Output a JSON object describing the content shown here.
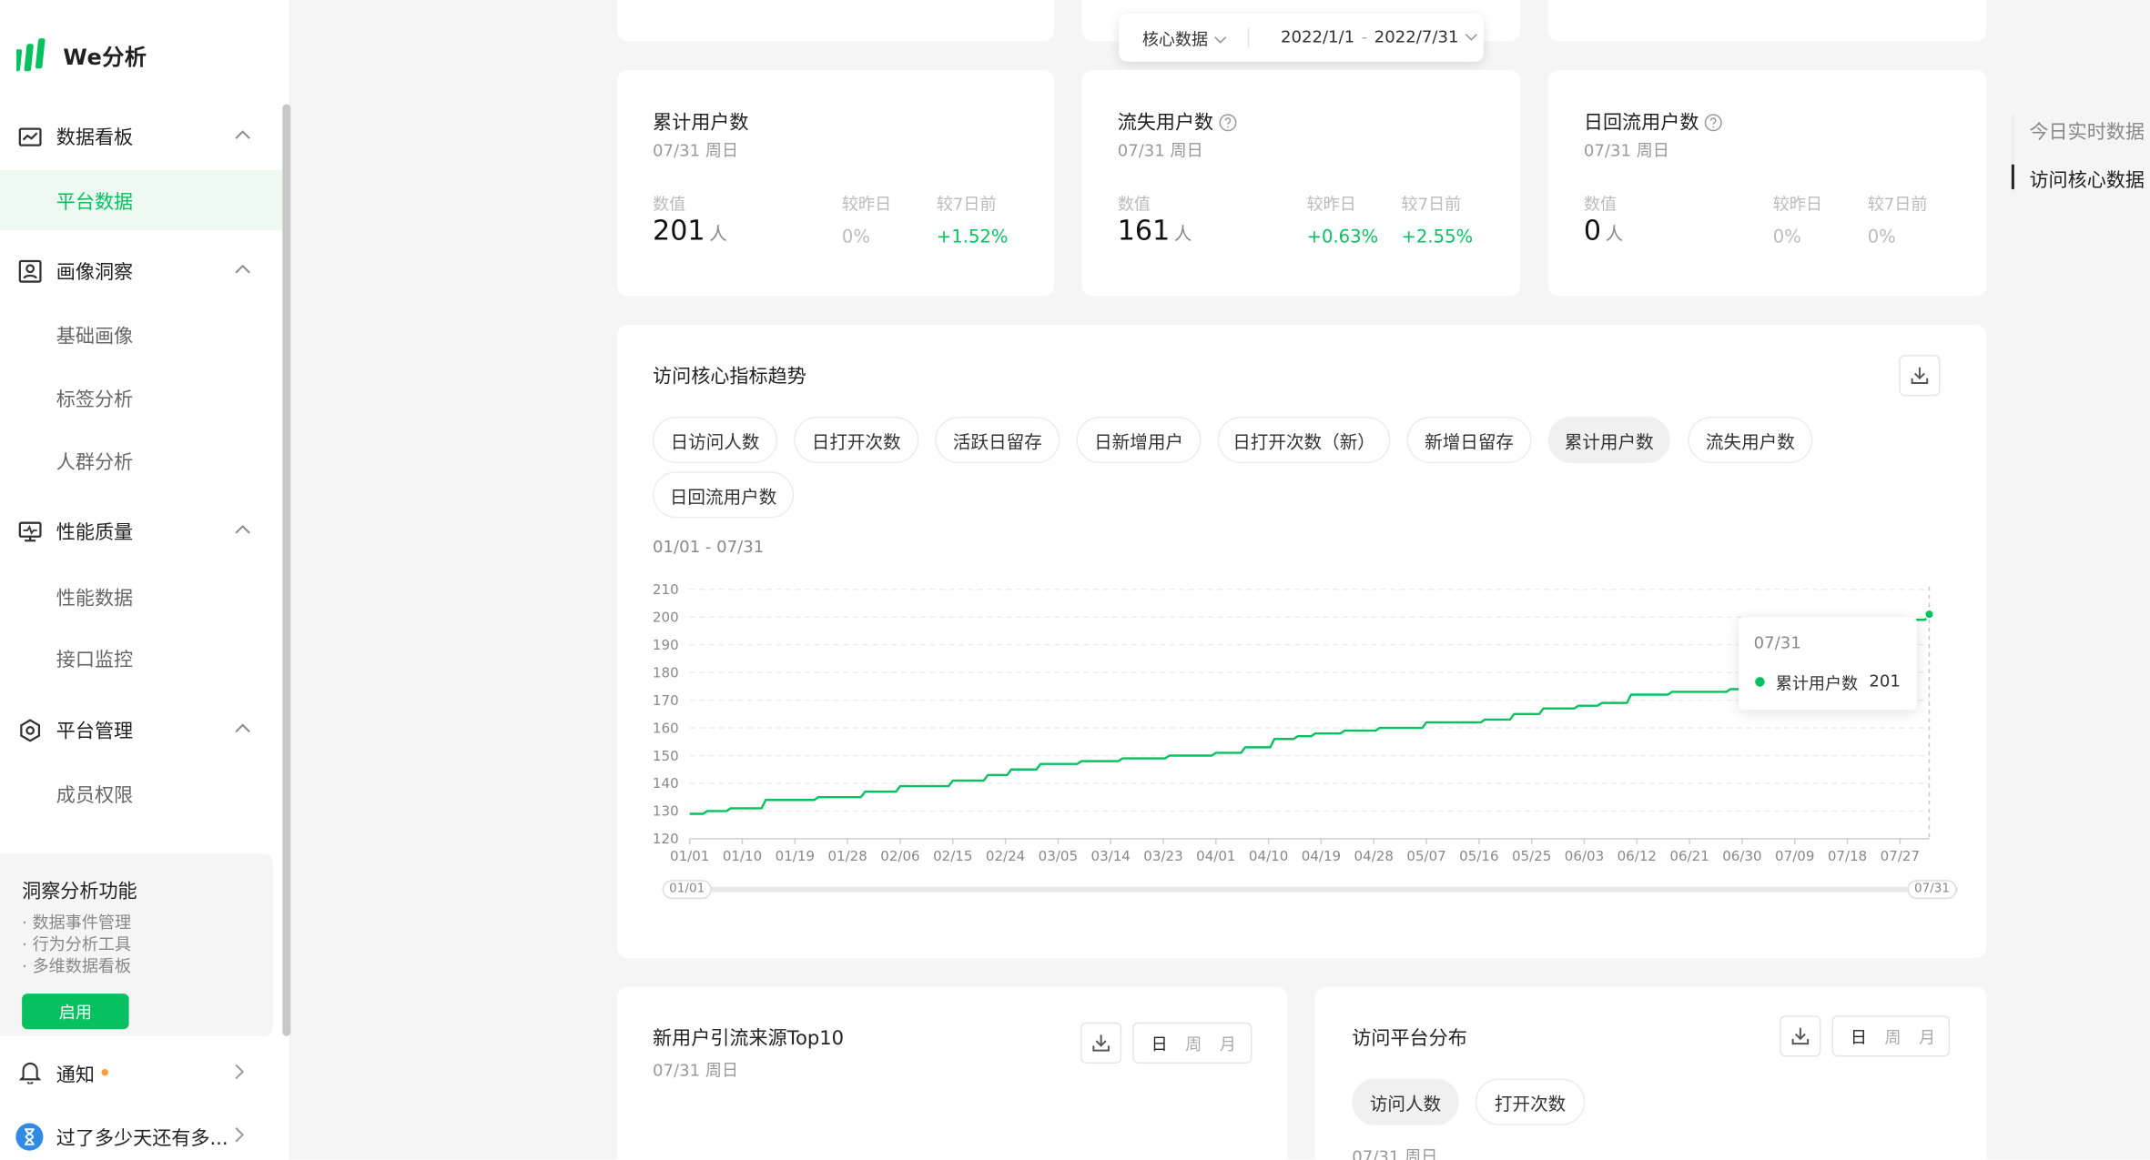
{
  "app": {
    "name": "We分析"
  },
  "sidebar": {
    "groups": [
      {
        "label": "数据看板",
        "items": [
          {
            "label": "平台数据",
            "active": true
          }
        ]
      },
      {
        "label": "画像洞察",
        "items": [
          {
            "label": "基础画像"
          },
          {
            "label": "标签分析"
          },
          {
            "label": "人群分析"
          }
        ]
      },
      {
        "label": "性能质量",
        "items": [
          {
            "label": "性能数据"
          },
          {
            "label": "接口监控"
          }
        ]
      },
      {
        "label": "平台管理",
        "items": [
          {
            "label": "成员权限"
          }
        ]
      }
    ],
    "promo": {
      "title": "洞察分析功能",
      "features": [
        "· 数据事件管理",
        "· 行为分析工具",
        "· 多维数据看板"
      ],
      "button": "启用"
    },
    "notice": {
      "label": "通知"
    },
    "user": {
      "label": "过了多少天还有多..."
    }
  },
  "filter_bar": {
    "scope": "核心数据",
    "date_start": "2022/1/1",
    "date_sep": "-",
    "date_end": "2022/7/31"
  },
  "kpi_labels": {
    "value": "数值",
    "vs_yesterday": "较昨日",
    "vs_7days": "较7日前"
  },
  "kpis": [
    {
      "title": "累计用户数",
      "date": "07/31 周日",
      "value": "201",
      "unit": "人",
      "dod": "0%",
      "wow": "+1.52%",
      "dod_green": false,
      "wow_green": true,
      "help": false
    },
    {
      "title": "流失用户数",
      "date": "07/31 周日",
      "value": "161",
      "unit": "人",
      "dod": "+0.63%",
      "wow": "+2.55%",
      "dod_green": true,
      "wow_green": true,
      "help": true
    },
    {
      "title": "日回流用户数",
      "date": "07/31 周日",
      "value": "0",
      "unit": "人",
      "dod": "0%",
      "wow": "0%",
      "dod_green": false,
      "wow_green": false,
      "help": true
    }
  ],
  "trend": {
    "title": "访问核心指标趋势",
    "tabs": [
      "日访问人数",
      "日打开次数",
      "活跃日留存",
      "日新增用户",
      "日打开次数（新）",
      "新增日留存",
      "累计用户数",
      "流失用户数",
      "日回流用户数"
    ],
    "active_tab": "累计用户数",
    "range_label": "01/01 - 07/31",
    "slider": {
      "start": "01/01",
      "end": "07/31"
    },
    "tooltip": {
      "date": "07/31",
      "series": "累计用户数",
      "value": "201"
    }
  },
  "chart_data": {
    "type": "line",
    "series": [
      {
        "name": "累计用户数",
        "color": "#07c160",
        "values": [
          [
            0,
            129
          ],
          [
            3,
            130
          ],
          [
            7,
            131
          ],
          [
            13,
            134
          ],
          [
            22,
            135
          ],
          [
            30,
            137
          ],
          [
            36,
            139
          ],
          [
            45,
            141
          ],
          [
            51,
            143
          ],
          [
            55,
            145
          ],
          [
            60,
            147
          ],
          [
            67,
            148
          ],
          [
            74,
            149
          ],
          [
            82,
            150
          ],
          [
            90,
            151
          ],
          [
            95,
            153
          ],
          [
            100,
            156
          ],
          [
            104,
            157
          ],
          [
            107,
            158
          ],
          [
            112,
            159
          ],
          [
            118,
            160
          ],
          [
            126,
            162
          ],
          [
            136,
            163
          ],
          [
            141,
            165
          ],
          [
            146,
            167
          ],
          [
            152,
            168
          ],
          [
            156,
            169
          ],
          [
            161,
            172
          ],
          [
            168,
            173
          ],
          [
            178,
            174
          ],
          [
            182,
            175
          ],
          [
            186,
            178
          ],
          [
            189,
            182
          ],
          [
            193,
            185
          ],
          [
            197,
            188
          ],
          [
            202,
            190
          ],
          [
            206,
            195
          ],
          [
            209,
            199
          ],
          [
            212,
            201
          ]
        ]
      }
    ],
    "x_ticks": [
      "01/01",
      "01/10",
      "01/19",
      "01/28",
      "02/06",
      "02/15",
      "02/24",
      "03/05",
      "03/14",
      "03/23",
      "04/01",
      "04/10",
      "04/19",
      "04/28",
      "05/07",
      "05/16",
      "05/25",
      "06/03",
      "06/12",
      "06/21",
      "06/30",
      "07/09",
      "07/18",
      "07/27"
    ],
    "x_tick_days": [
      0,
      9,
      18,
      27,
      36,
      45,
      54,
      63,
      72,
      81,
      90,
      99,
      108,
      117,
      126,
      135,
      144,
      153,
      162,
      171,
      180,
      189,
      198,
      207
    ],
    "x_range": [
      "01/01",
      "07/31"
    ],
    "ylim": [
      120,
      210
    ],
    "y_ticks": [
      120,
      130,
      140,
      150,
      160,
      170,
      180,
      190,
      200,
      210
    ],
    "grid": true
  },
  "bottom_left": {
    "title": "新用户引流来源Top10",
    "date": "07/31 周日",
    "seg": [
      "日",
      "周",
      "月"
    ]
  },
  "bottom_right": {
    "title": "访问平台分布",
    "seg": [
      "日",
      "周",
      "月"
    ],
    "tabs": [
      "访问人数",
      "打开次数"
    ],
    "date": "07/31 周日"
  },
  "anchors": [
    {
      "label": "今日实时数据",
      "active": false
    },
    {
      "label": "访问核心数据",
      "active": true
    }
  ],
  "colors": {
    "accent": "#07c160",
    "notice_dot": "#fa9d3b"
  }
}
